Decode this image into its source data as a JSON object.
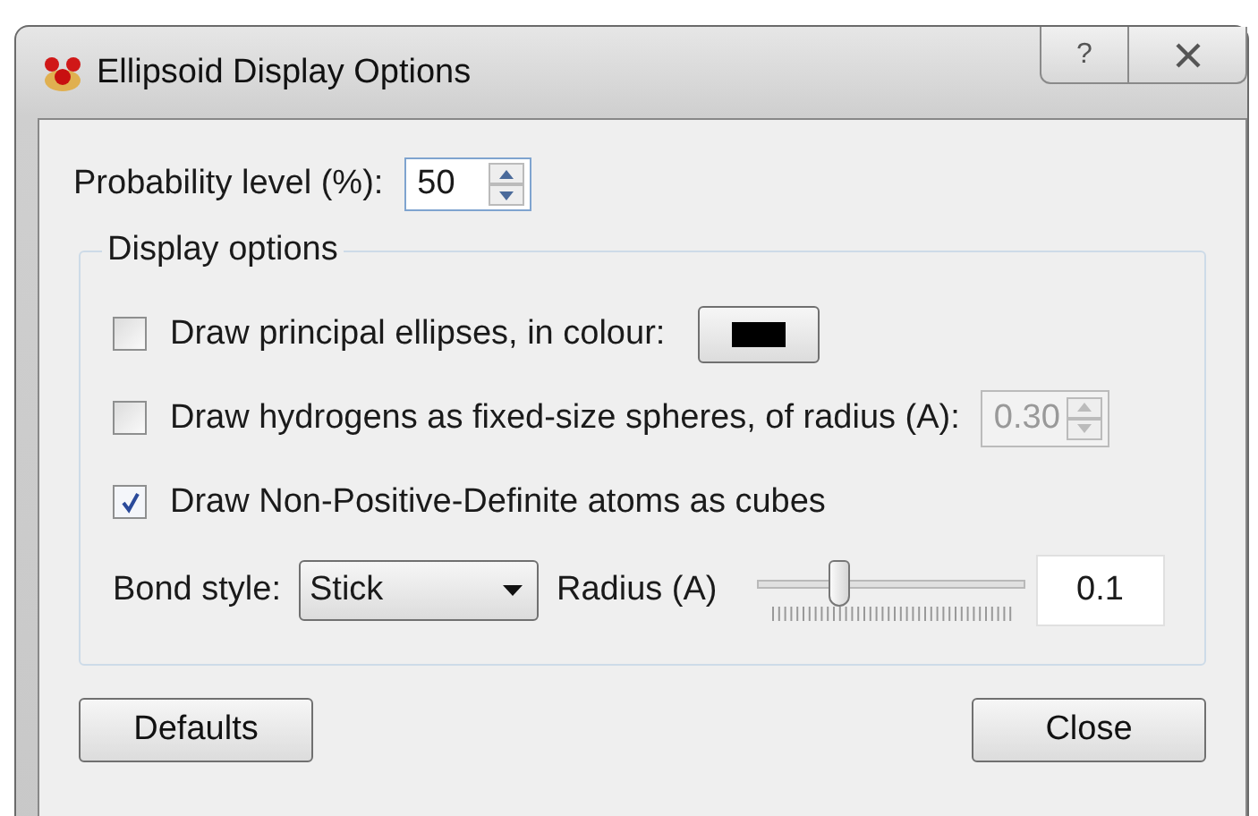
{
  "window": {
    "title": "Ellipsoid Display Options",
    "help": "?"
  },
  "probability": {
    "label": "Probability level (%):",
    "value": "50"
  },
  "display_options": {
    "title": "Display options",
    "options": [
      {
        "kind": "color",
        "label": "Draw principal ellipses, in colour:",
        "checked": false,
        "color": "#000000"
      },
      {
        "kind": "spin",
        "label": "Draw hydrogens as fixed-size spheres, of radius (A):",
        "checked": false,
        "value": "0.30",
        "disabled": true
      },
      {
        "kind": "plain",
        "label": "Draw Non-Positive-Definite atoms as cubes",
        "checked": true
      }
    ],
    "bond_style": {
      "label": "Bond style:",
      "value": "Stick"
    },
    "radius": {
      "label": "Radius (A)",
      "level": 0.27,
      "value": "0.1"
    }
  },
  "buttons": [
    {
      "label": "Defaults"
    },
    {
      "label": "Close"
    }
  ]
}
